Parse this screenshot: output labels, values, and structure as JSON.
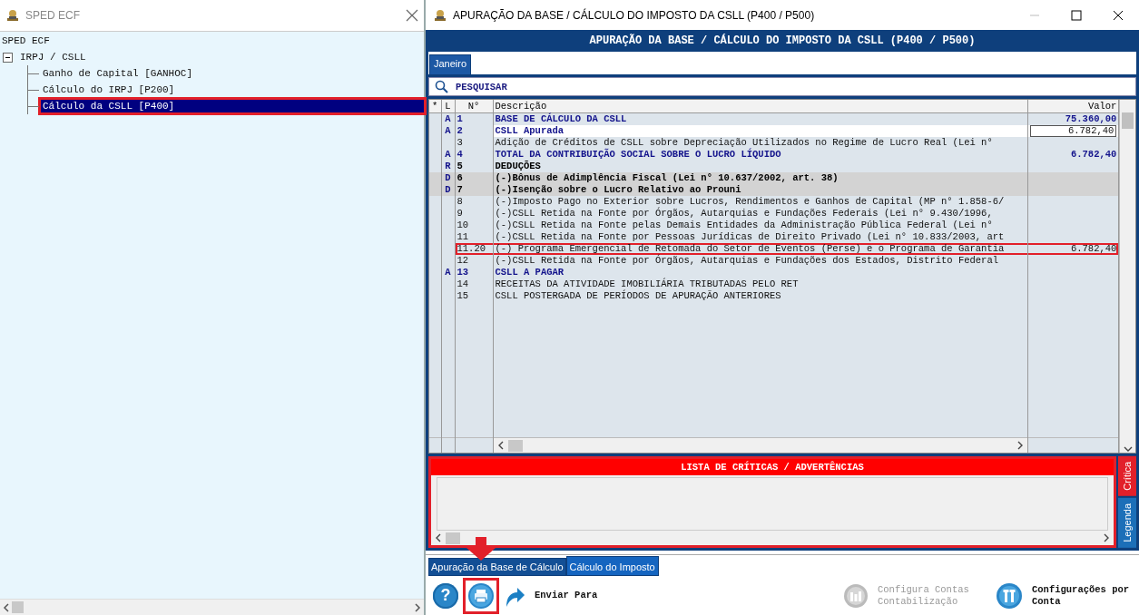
{
  "left_window": {
    "title": "SPED ECF",
    "tree": [
      {
        "label": "SPED ECF",
        "selected": false,
        "annotated": false,
        "children": [
          {
            "label": "IRPJ / CSLL",
            "selected": false,
            "annotated": false,
            "expanded": true,
            "children": [
              {
                "label": "Ganho de Capital [GANHOC]",
                "selected": false,
                "annotated": false
              },
              {
                "label": "Cálculo do IRPJ [P200]",
                "selected": false,
                "annotated": false
              },
              {
                "label": "Cálculo da CSLL [P400]",
                "selected": true,
                "annotated": true
              }
            ]
          }
        ]
      }
    ]
  },
  "main_window": {
    "title": "APURAÇÃO DA BASE / CÁLCULO DO IMPOSTO DA CSLL (P400 / P500)",
    "header": "APURAÇÃO DA BASE / CÁLCULO DO IMPOSTO DA CSLL (P400 / P500)",
    "tabs": [
      {
        "label": "Janeiro",
        "selected": true
      }
    ],
    "search": {
      "label": "PESQUISAR"
    },
    "grid": {
      "columns": [
        "*",
        "L",
        "N°",
        "Descrição",
        "Valor"
      ],
      "rows": [
        {
          "kind": "total",
          "flag": "A",
          "number": "1",
          "description": "BASE DE CÁLCULO DA CSLL",
          "value": "75.360,00",
          "selected": false,
          "annotated": false
        },
        {
          "kind": "total",
          "flag": "A",
          "number": "2",
          "description": "CSLL Apurada",
          "value": "6.782,40",
          "selected": true,
          "annotated": false
        },
        {
          "kind": "normal",
          "flag": "",
          "number": "3",
          "description": "Adição de Créditos de CSLL sobre Depreciação Utilizados no Regime de Lucro Real (Lei n°",
          "value": "",
          "selected": false,
          "annotated": false
        },
        {
          "kind": "total",
          "flag": "A",
          "number": "4",
          "description": "TOTAL DA CONTRIBUIÇÃO SOCIAL SOBRE O LUCRO LÍQUIDO",
          "value": "6.782,40",
          "selected": false,
          "annotated": false
        },
        {
          "kind": "heading",
          "flag": "R",
          "number": "5",
          "description": "DEDUÇÕES",
          "value": "",
          "selected": false,
          "annotated": false
        },
        {
          "kind": "deduction",
          "flag": "D",
          "number": "6",
          "description": "(-)Bônus de Adimplência Fiscal (Lei n° 10.637/2002, art. 38)",
          "value": "",
          "selected": false,
          "annotated": false
        },
        {
          "kind": "deduction",
          "flag": "D",
          "number": "7",
          "description": "(-)Isenção sobre o Lucro Relativo ao Prouni",
          "value": "",
          "selected": false,
          "annotated": false
        },
        {
          "kind": "normal",
          "flag": "",
          "number": "8",
          "description": "(-)Imposto Pago no Exterior sobre Lucros, Rendimentos e Ganhos de Capital (MP n° 1.858-6/",
          "value": "",
          "selected": false,
          "annotated": false
        },
        {
          "kind": "normal",
          "flag": "",
          "number": "9",
          "description": "(-)CSLL Retida na Fonte por Órgãos, Autarquias e Fundações Federais (Lei n° 9.430/1996,",
          "value": "",
          "selected": false,
          "annotated": false
        },
        {
          "kind": "normal",
          "flag": "",
          "number": "10",
          "description": "(-)CSLL Retida na Fonte pelas Demais Entidades da Administração Pública Federal (Lei n°",
          "value": "",
          "selected": false,
          "annotated": false
        },
        {
          "kind": "normal",
          "flag": "",
          "number": "11",
          "description": "(-)CSLL Retida na Fonte por Pessoas Jurídicas de Direito Privado (Lei n° 10.833/2003, art",
          "value": "",
          "selected": false,
          "annotated": false
        },
        {
          "kind": "normal",
          "flag": "",
          "number": "11.20",
          "description": "(-) Programa Emergencial de Retomada do Setor de Eventos (Perse) e o Programa de Garantia",
          "value": "6.782,40",
          "selected": false,
          "annotated": true
        },
        {
          "kind": "normal",
          "flag": "",
          "number": "12",
          "description": "(-)CSLL Retida na Fonte por Órgãos, Autarquias e Fundações dos Estados, Distrito Federal",
          "value": "",
          "selected": false,
          "annotated": false
        },
        {
          "kind": "total",
          "flag": "A",
          "number": "13",
          "description": "CSLL A PAGAR",
          "value": "",
          "selected": false,
          "annotated": false
        },
        {
          "kind": "normal",
          "flag": "",
          "number": "14",
          "description": "RECEITAS DA ATIVIDADE IMOBILIÁRIA TRIBUTADAS PELO RET",
          "value": "",
          "selected": false,
          "annotated": false
        },
        {
          "kind": "normal",
          "flag": "",
          "number": "15",
          "description": "CSLL POSTERGADA DE PERÍODOS DE APURAÇÃO ANTERIORES",
          "value": "",
          "selected": false,
          "annotated": false
        }
      ]
    },
    "critics_panel": {
      "title": "LISTA DE CRÍTICAS / ADVERTÊNCIAS",
      "side_tabs": [
        {
          "label": "Crítica",
          "selected": true
        },
        {
          "label": "Legenda",
          "selected": false
        }
      ]
    },
    "bottom_tabs": [
      {
        "label": "Apuração da Base de Cálculo",
        "selected": false
      },
      {
        "label": "Cálculo do Imposto",
        "selected": true
      }
    ],
    "toolbar": [
      {
        "kind": "help",
        "glyph": "?",
        "disabled": false,
        "annotated": false
      },
      {
        "kind": "print",
        "disabled": false,
        "annotated": true
      },
      {
        "kind": "send",
        "label": "Enviar Para",
        "disabled": false,
        "annotated": false
      },
      {
        "kind": "accounts",
        "label": "Configura Contas Contabilização",
        "disabled": true,
        "annotated": false
      },
      {
        "kind": "settings",
        "label": "Configurações por Conta",
        "disabled": false,
        "annotated": false
      }
    ]
  }
}
